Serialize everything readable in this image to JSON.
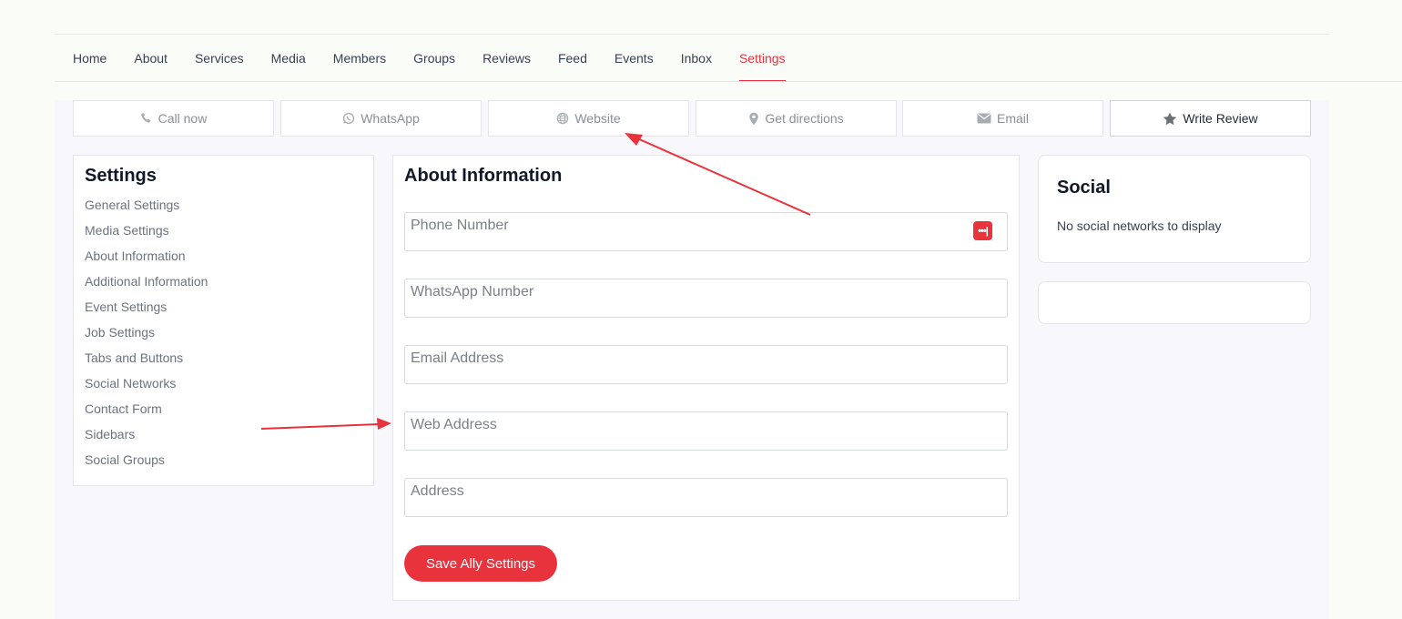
{
  "nav": {
    "items": [
      {
        "label": "Home",
        "active": false
      },
      {
        "label": "About",
        "active": false
      },
      {
        "label": "Services",
        "active": false
      },
      {
        "label": "Media",
        "active": false
      },
      {
        "label": "Members",
        "active": false
      },
      {
        "label": "Groups",
        "active": false
      },
      {
        "label": "Reviews",
        "active": false
      },
      {
        "label": "Feed",
        "active": false
      },
      {
        "label": "Events",
        "active": false
      },
      {
        "label": "Inbox",
        "active": false
      },
      {
        "label": "Settings",
        "active": true
      }
    ]
  },
  "actions": [
    {
      "label": "Call now",
      "icon": "phone-icon"
    },
    {
      "label": "WhatsApp",
      "icon": "whatsapp-icon"
    },
    {
      "label": "Website",
      "icon": "globe-icon"
    },
    {
      "label": "Get directions",
      "icon": "map-pin-icon"
    },
    {
      "label": "Email",
      "icon": "envelope-icon"
    },
    {
      "label": "Write Review",
      "icon": "star-icon"
    }
  ],
  "settings": {
    "title": "Settings",
    "links": [
      "General Settings",
      "Media Settings",
      "About Information",
      "Additional Information",
      "Event Settings",
      "Job Settings",
      "Tabs and Buttons",
      "Social Networks",
      "Contact Form",
      "Sidebars",
      "Social Groups"
    ]
  },
  "about": {
    "title": "About Information",
    "fields": [
      {
        "placeholder": "Phone Number"
      },
      {
        "placeholder": "WhatsApp Number"
      },
      {
        "placeholder": "Email Address"
      },
      {
        "placeholder": "Web Address"
      },
      {
        "placeholder": "Address"
      }
    ],
    "save_label": "Save Ally Settings",
    "password_icon_text": "•••|"
  },
  "social": {
    "title": "Social",
    "empty_text": "No social networks to display"
  },
  "colors": {
    "accent": "#e8323c",
    "annotation_arrow": "#e8323c"
  }
}
